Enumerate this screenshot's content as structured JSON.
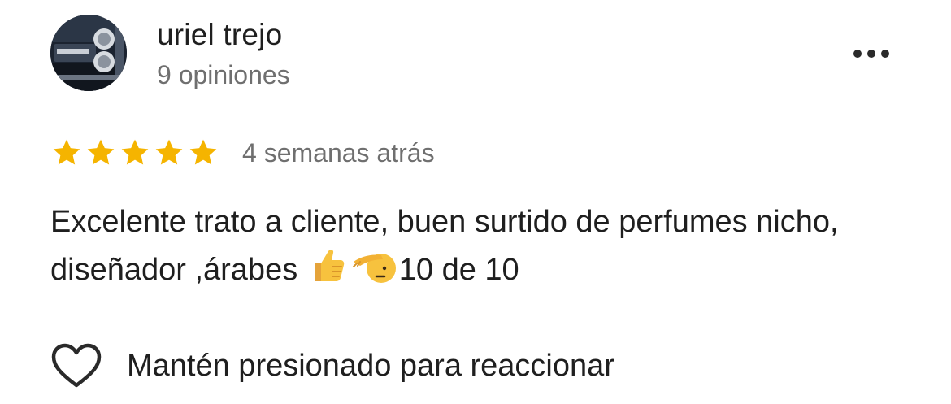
{
  "reviewer": {
    "name": "uriel trejo",
    "review_count": "9 opiniones"
  },
  "rating": {
    "stars": 5,
    "max": 5,
    "star_color": "#F5B400",
    "time_ago": "4 semanas atrás"
  },
  "review": {
    "text_before_emoji": "Excelente trato a cliente, buen surtido de perfumes nicho, diseñador ,árabes ",
    "emojis": [
      "thumbs-up-emoji",
      "saluting-face-emoji"
    ],
    "text_after_emoji": "10 de 10"
  },
  "actions": {
    "more_icon": "more-horizontal-icon",
    "react_icon": "heart-outline-icon",
    "react_label": "Mantén presionado para reaccionar"
  }
}
